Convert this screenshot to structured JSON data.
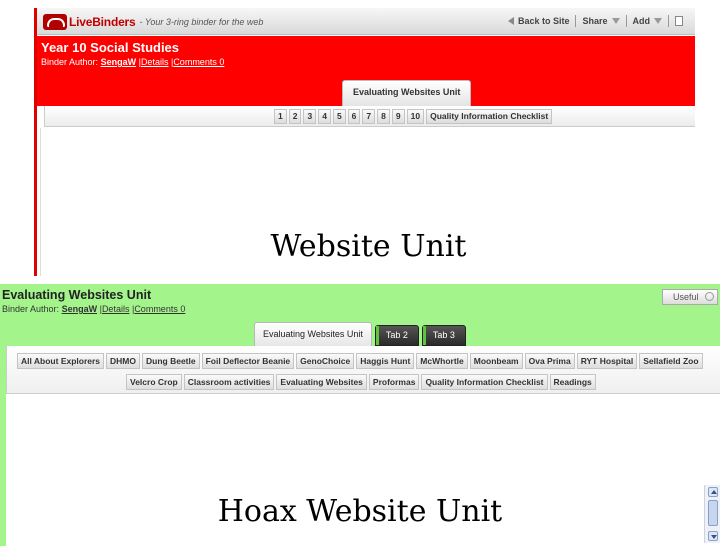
{
  "top_binder": {
    "app": {
      "name": "LiveBinders",
      "tagline": "- Your 3-ring binder for the web"
    },
    "toolbar": {
      "back": "Back to Site",
      "share": "Share",
      "add": "Add"
    },
    "title": "Year 10 Social Studies",
    "meta": {
      "author_label": "Binder Author:",
      "author": "SengaW",
      "details": "Details",
      "comments": "Comments 0",
      "sep": "|"
    },
    "tabs": [
      {
        "label": "Evaluating Websites Unit"
      }
    ],
    "subtabs": [
      "1",
      "2",
      "3",
      "4",
      "5",
      "6",
      "7",
      "8",
      "9",
      "10",
      "Quality Information Checklist"
    ],
    "content_title": "Website Unit",
    "colors": {
      "header": "#ff0000"
    }
  },
  "bottom_binder": {
    "title": "Evaluating Websites Unit",
    "meta": {
      "author_label": "Binder Author:",
      "author": "SengaW",
      "details": "Details",
      "comments": "Comments 0",
      "sep": "|"
    },
    "useful_label": "Useful",
    "tabs": [
      {
        "label": "Evaluating Websites Unit"
      },
      {
        "label": "Tab 2"
      },
      {
        "label": "Tab 3"
      }
    ],
    "subtabs_row1": [
      "All About Explorers",
      "DHMO",
      "Dung Beetle",
      "Foil Deflector Beanie",
      "GenoChoice",
      "Haggis Hunt",
      "McWhortle",
      "Moonbeam",
      "Ova Prima",
      "RYT Hospital",
      "Sellafield Zoo"
    ],
    "subtabs_row2": [
      "Velcro Crop",
      "Classroom activities",
      "Evaluating Websites",
      "Proformas",
      "Quality Information Checklist",
      "Readings"
    ],
    "content_title": "Hoax Website Unit",
    "colors": {
      "header": "#a4f48c"
    }
  }
}
